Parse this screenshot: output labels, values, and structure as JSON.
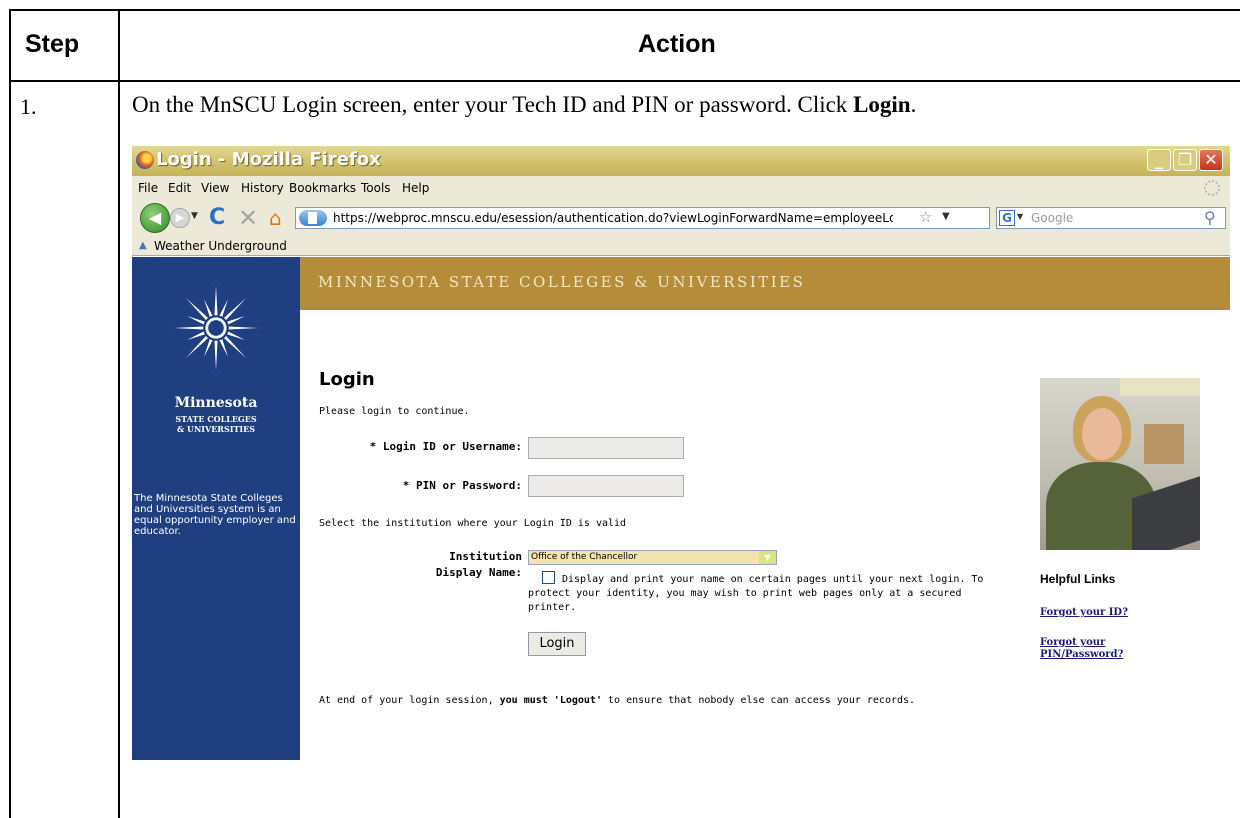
{
  "table": {
    "header_step": "Step",
    "header_action": "Action",
    "step_number": "1.",
    "instruction_text": "On the MnSCU Login screen, enter your Tech ID and PIN or password. Click ",
    "instruction_bold": "Login",
    "instruction_end": "."
  },
  "browser": {
    "window_title": "Login - Mozilla Firefox",
    "menu": [
      "File",
      "Edit",
      "View",
      "History",
      "Bookmarks",
      "Tools",
      "Help"
    ],
    "url": "https://webproc.mnscu.edu/esession/authentication.do?viewLoginForwardName=employeeLc",
    "search_placeholder": "Google",
    "bookmark": "Weather Underground"
  },
  "sidebar": {
    "org_name": "Minnesota",
    "org_sub1": "STATE COLLEGES",
    "org_sub2": "& UNIVERSITIES",
    "eo_statement": "The Minnesota State Colleges and Universities system is an equal opportunity employer and educator."
  },
  "banner": {
    "text": "MINNESOTA STATE COLLEGES & UNIVERSITIES"
  },
  "login": {
    "title": "Login",
    "subtitle": "Please login to continue.",
    "login_id_label": "* Login ID or Username:",
    "pin_label": "* PIN or Password:",
    "login_id_value": "",
    "pin_value": "",
    "institution_prompt": "Select the institution where your Login ID is valid",
    "institution_label": "Institution",
    "institution_value": "Office of the Chancellor",
    "display_name_label": "Display Name:",
    "display_name_checked": false,
    "display_name_line1": "Display and print your name on certain pages until your next login. To",
    "display_name_line2": "protect your identity, you may wish to print web pages only at a secured",
    "display_name_line3": "printer.",
    "button_label": "Login",
    "footer_pre": "At end of your login session, ",
    "footer_bold": "you must 'Logout'",
    "footer_post": " to ensure that nobody else can access your records."
  },
  "helpful_links": {
    "heading": "Helpful Links",
    "forgot_id": "Forgot your ID?",
    "forgot_pin_line1": "Forgot your",
    "forgot_pin_line2": "PIN/Password?"
  },
  "colors": {
    "sidebar_blue": "#1f3f80",
    "banner_gold": "#b58d3a",
    "firefox_titlebar": "#d2c370"
  }
}
